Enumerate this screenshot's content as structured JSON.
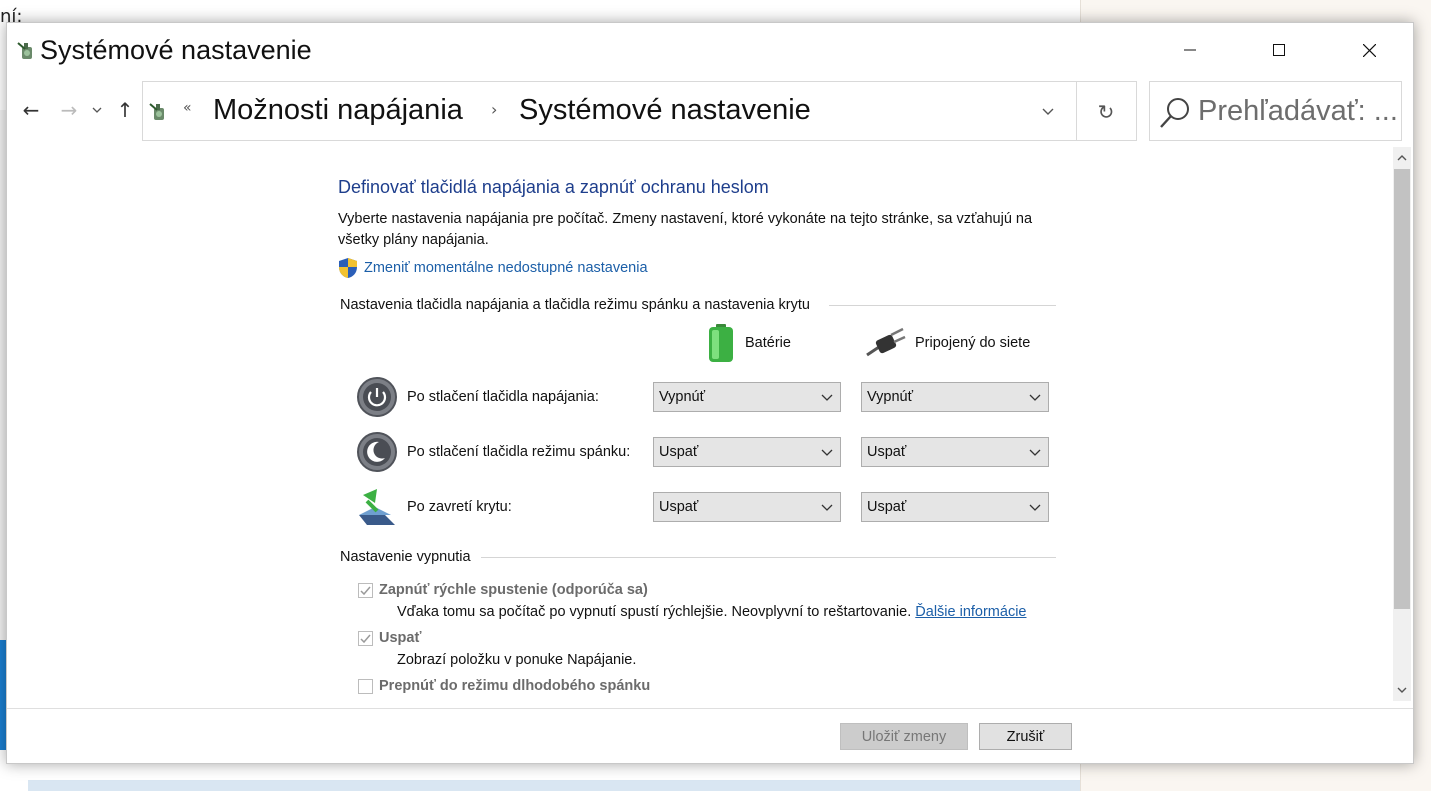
{
  "background": {
    "partial_text": "ní:"
  },
  "window": {
    "title": "Systémové nastavenie",
    "controls": {
      "minimize": "minimize",
      "maximize": "maximize",
      "close": "close"
    }
  },
  "nav": {
    "back": "←",
    "forward": "→",
    "recent": "⌄",
    "up": "↑",
    "overflow": "«",
    "breadcrumb": [
      "Možnosti napájania",
      "Systémové nastavenie"
    ],
    "separator": "›",
    "refresh": "↻",
    "search_placeholder": "Prehľadávať: ..."
  },
  "content": {
    "heading": "Definovať tlačidlá napájania a zapnúť ochranu heslom",
    "description": "Vyberte nastavenia napájania pre počítač. Zmeny nastavení, ktoré vykonáte na tejto stránke, sa vzťahujú na všetky plány napájania.",
    "change_link": "Zmeniť momentálne nedostupné nastavenia",
    "buttons_group_title": "Nastavenia tlačidla napájania a tlačidla režimu spánku a nastavenia krytu",
    "columns": {
      "battery": "Batérie",
      "plugged": "Pripojený do siete"
    },
    "rows": [
      {
        "label": "Po stlačení tlačidla napájania:",
        "battery": "Vypnúť",
        "plugged": "Vypnúť"
      },
      {
        "label": "Po stlačení tlačidla režimu spánku:",
        "battery": "Uspať",
        "plugged": "Uspať"
      },
      {
        "label": "Po zavretí krytu:",
        "battery": "Uspať",
        "plugged": "Uspať"
      }
    ],
    "shutdown_group_title": "Nastavenie vypnutia",
    "shutdown_options": [
      {
        "label": "Zapnúť rýchle spustenie (odporúča sa)",
        "checked": true,
        "desc": "Vďaka tomu sa počítač po vypnutí spustí rýchlejšie. Neovplyvní to reštartovanie.",
        "link": "Ďalšie informácie"
      },
      {
        "label": "Uspať",
        "checked": true,
        "desc": "Zobrazí položku v ponuke Napájanie."
      },
      {
        "label": "Prepnúť do režimu dlhodobého spánku",
        "checked": false
      }
    ]
  },
  "footer": {
    "save": "Uložiť zmeny",
    "cancel": "Zrušiť"
  },
  "colors": {
    "heading": "#1e3e8c",
    "link": "#1c5fa8",
    "select_bg": "#e5e5e5"
  }
}
